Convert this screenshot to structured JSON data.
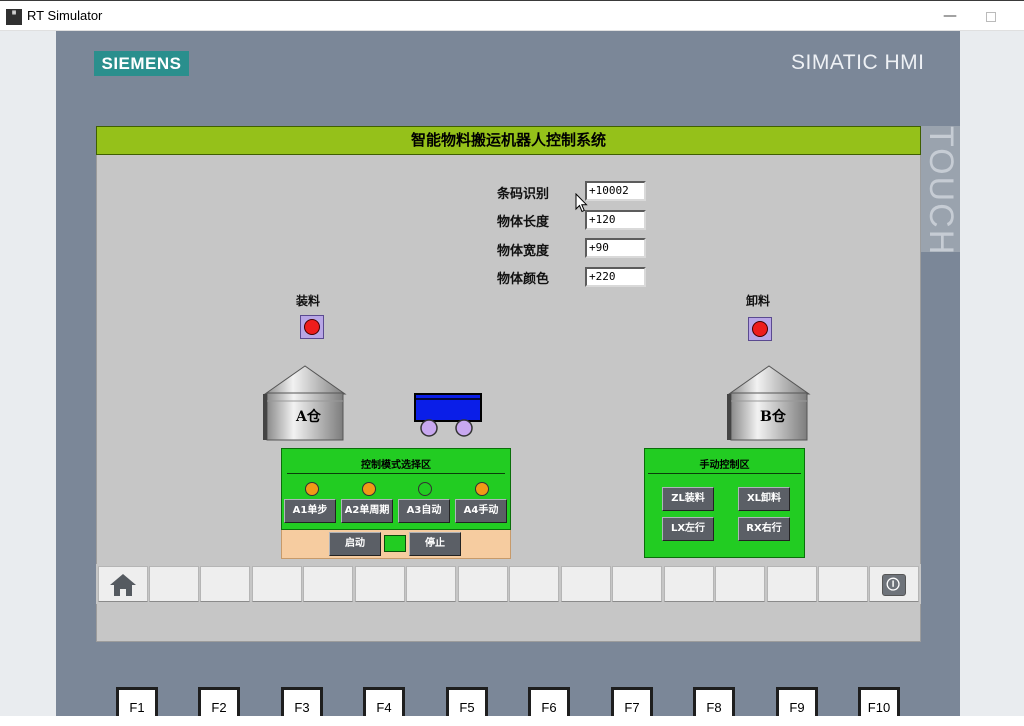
{
  "window": {
    "title": "RT Simulator",
    "minimize_label": "—"
  },
  "panel": {
    "brand": "SIEMENS",
    "model": "SIMATIC HMI",
    "touch_label": "TOUCH"
  },
  "screen": {
    "title": "智能物料搬运机器人控制系统",
    "fields": [
      {
        "label": "条码识别",
        "value": "+10002"
      },
      {
        "label": "物体长度",
        "value": "+120"
      },
      {
        "label": "物体宽度",
        "value": "+90"
      },
      {
        "label": "物体颜色",
        "value": "+220"
      }
    ],
    "load_lamp": {
      "label": "装料",
      "color": "#ee1c1c"
    },
    "unload_lamp": {
      "label": "卸料",
      "color": "#ee1c1c"
    },
    "silo_a": "A仓",
    "silo_b": "B仓",
    "mode_panel": {
      "title": "控制模式选择区",
      "lamps": [
        {
          "color": "#f29a16"
        },
        {
          "color": "#f29a16"
        },
        {
          "color": "#22cc22"
        },
        {
          "color": "#f29a16"
        }
      ],
      "buttons": [
        "A1单步",
        "A2单周期",
        "A3自动",
        "A4手动"
      ],
      "start_label": "启动",
      "stop_label": "停止"
    },
    "manual_panel": {
      "title": "手动控制区",
      "buttons": [
        "ZL装料",
        "XL卸料",
        "LX左行",
        "RX右行"
      ]
    }
  },
  "function_keys": [
    "F1",
    "F2",
    "F3",
    "F4",
    "F5",
    "F6",
    "F7",
    "F8",
    "F9",
    "F10"
  ]
}
